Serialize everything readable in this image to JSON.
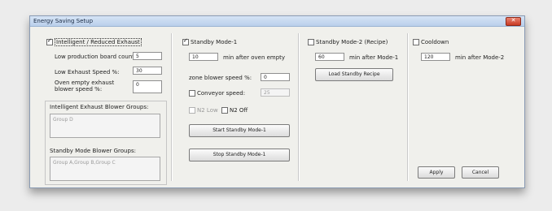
{
  "window": {
    "title": "Energy Saving Setup"
  },
  "intelligent": {
    "checkbox_label": "Intelligent / Reduced Exhaust",
    "checked": true,
    "low_production_label": "Low production board count:",
    "low_production_value": "5",
    "low_exhaust_label": "Low Exhaust Speed %:",
    "low_exhaust_value": "30",
    "oven_empty_label_1": "Oven empty exhaust",
    "oven_empty_label_2": "blower speed %:",
    "oven_empty_value": "0",
    "exhaust_groups_label": "Intelligent Exhaust Blower Groups:",
    "exhaust_groups_value": "Group D",
    "standby_groups_label": "Standby Mode Blower Groups:",
    "standby_groups_value": "Group A,Group B,Group C"
  },
  "standby1": {
    "checkbox_label": "Standby Mode-1",
    "checked": true,
    "minutes_value": "10",
    "minutes_suffix": "min after oven empty",
    "zone_blower_label": "zone blower speed %:",
    "zone_blower_value": "0",
    "conveyor_label": "Conveyor speed:",
    "conveyor_value": "25",
    "n2_low_label": "N2 Low",
    "n2_off_label": "N2 Off",
    "start_button": "Start Standby Mode-1",
    "stop_button": "Stop Standby Mode-1"
  },
  "standby2": {
    "checkbox_label": "Standby Mode-2 (Recipe)",
    "checked": false,
    "minutes_value": "60",
    "minutes_suffix": "min after Mode-1",
    "load_button": "Load Standby Recipe"
  },
  "cooldown": {
    "checkbox_label": "Cooldown",
    "checked": false,
    "minutes_value": "120",
    "minutes_suffix": "min after Mode-2"
  },
  "footer": {
    "apply_button": "Apply",
    "cancel_button": "Cancel"
  }
}
